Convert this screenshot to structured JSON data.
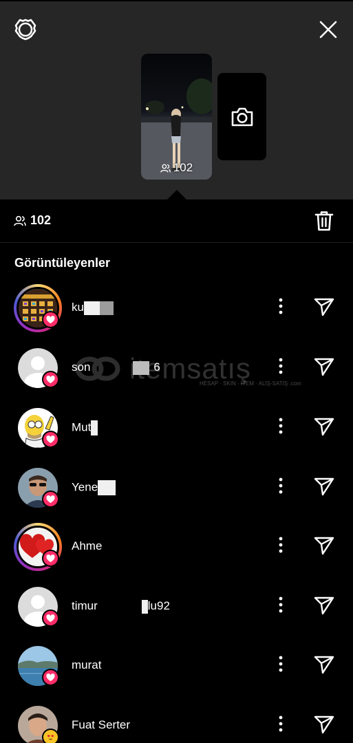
{
  "story": {
    "view_count": "102"
  },
  "stats": {
    "viewer_count": "102"
  },
  "section": {
    "title": "Görüntüleyenler"
  },
  "watermark": {
    "brand": "itemsatış",
    "tagline": "HESAP · SKIN · ITEM · ALIŞ-SATIŞ",
    "domain": ".com"
  },
  "viewers": [
    {
      "name": "ku",
      "suffix": "",
      "avatar": "game-screenshot",
      "ring": true
    },
    {
      "name": "son",
      "suffix": "6",
      "avatar": "default",
      "ring": false
    },
    {
      "name": "Mut",
      "suffix": "",
      "avatar": "cartoon",
      "ring": false
    },
    {
      "name": "Yene",
      "suffix": "",
      "avatar": "man-sunglasses",
      "ring": false
    },
    {
      "name": "Ahme",
      "suffix": "",
      "avatar": "hearts",
      "ring": true
    },
    {
      "name": "timur",
      "suffix": "lu92",
      "avatar": "default",
      "ring": false
    },
    {
      "name": "murat",
      "suffix": "",
      "avatar": "lake",
      "ring": false
    },
    {
      "name": "Fuat Serter",
      "suffix": "",
      "avatar": "man-emoji",
      "ring": false
    }
  ],
  "colors": {
    "top_background": "#262626",
    "background": "#000000",
    "like_badge": "#ff2d68",
    "text": "#ffffff"
  }
}
